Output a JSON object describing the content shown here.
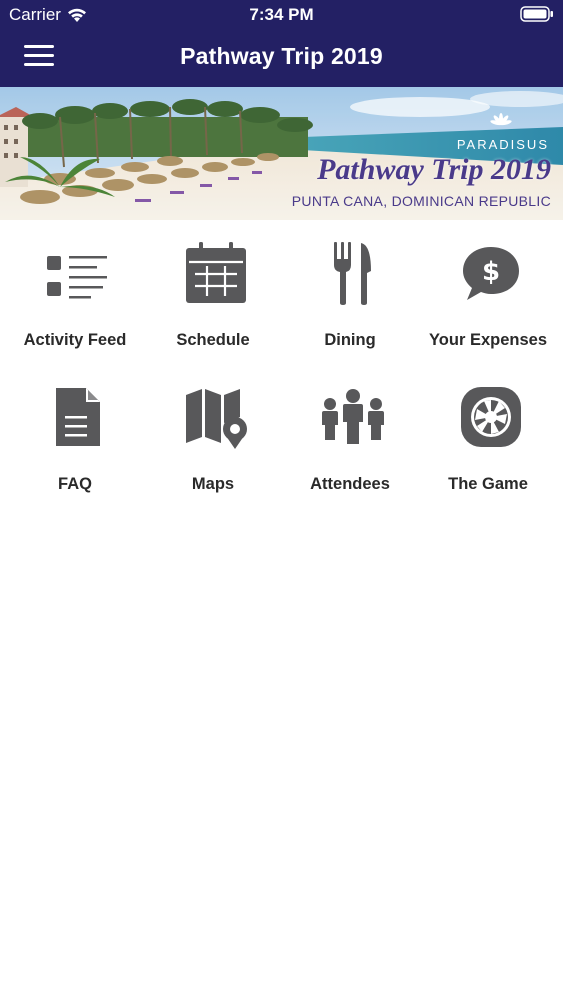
{
  "status_bar": {
    "carrier": "Carrier",
    "time": "7:34 PM"
  },
  "nav": {
    "title": "Pathway Trip 2019"
  },
  "banner": {
    "brand": "PARADISUS",
    "headline": "Pathway Trip 2019",
    "location": "PUNTA CANA, DOMINICAN REPUBLIC"
  },
  "menu": {
    "items": [
      {
        "label": "Activity Feed",
        "icon": "list-icon"
      },
      {
        "label": "Schedule",
        "icon": "calendar-icon"
      },
      {
        "label": "Dining",
        "icon": "fork-knife-icon"
      },
      {
        "label": "Your Expenses",
        "icon": "dollar-chat-icon"
      },
      {
        "label": "FAQ",
        "icon": "document-icon"
      },
      {
        "label": "Maps",
        "icon": "map-pin-icon"
      },
      {
        "label": "Attendees",
        "icon": "people-icon"
      },
      {
        "label": "The Game",
        "icon": "camera-aperture-icon"
      }
    ]
  },
  "colors": {
    "header": "#232064",
    "icon": "#58585a"
  }
}
